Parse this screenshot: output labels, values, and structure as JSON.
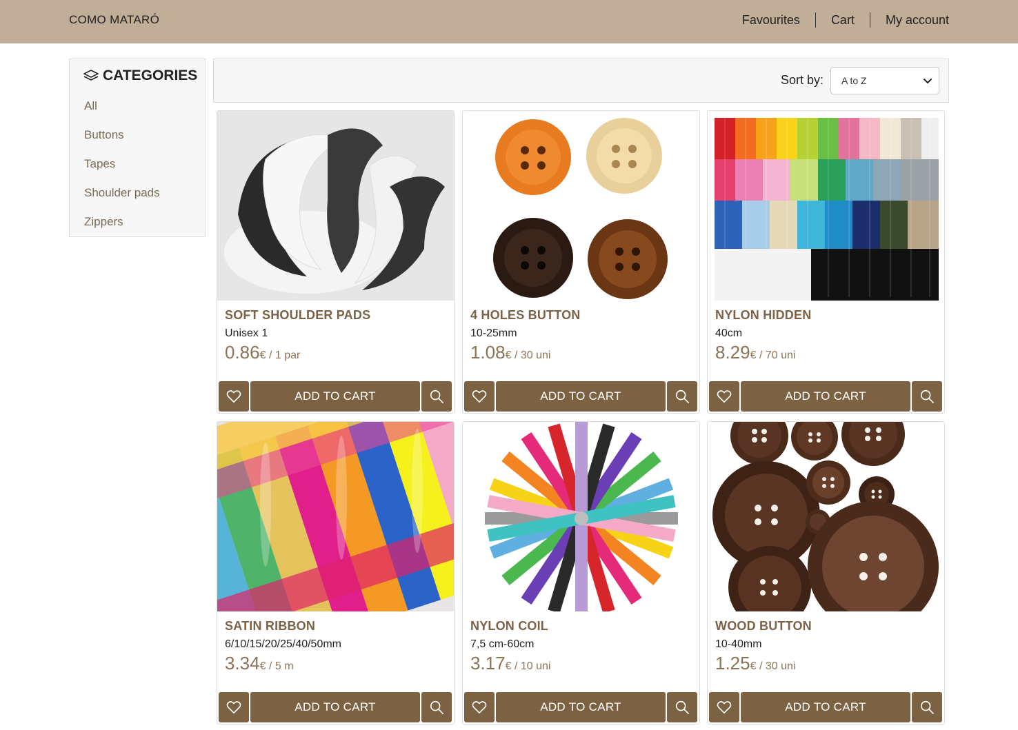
{
  "header": {
    "brand": "COMO MATARÓ",
    "nav": [
      "Favourites",
      "Cart",
      "My account"
    ]
  },
  "sidebar": {
    "title": "CATEGORIES",
    "items": [
      "All",
      "Buttons",
      "Tapes",
      "Shoulder pads",
      "Zippers"
    ]
  },
  "sort": {
    "label": "Sort by:",
    "selected": "A to Z"
  },
  "products": [
    {
      "name": "SOFT SHOULDER PADS",
      "desc": "Unisex 1",
      "price": "0.86",
      "unit": "€ / 1 par",
      "add_label": "ADD TO CART",
      "image": "shoulder-pads"
    },
    {
      "name": "4 HOLES BUTTON",
      "desc": "10-25mm",
      "price": "1.08",
      "unit": "€ / 30 uni",
      "add_label": "ADD TO CART",
      "image": "wood-buttons-four"
    },
    {
      "name": "NYLON HIDDEN",
      "desc": "40cm",
      "price": "8.29",
      "unit": "€ / 70 uni",
      "add_label": "ADD TO CART",
      "image": "zippers-rainbow"
    },
    {
      "name": "SATIN RIBBON",
      "desc": "6/10/15/20/25/40/50mm",
      "price": "3.34",
      "unit": "€ / 5 m",
      "add_label": "ADD TO CART",
      "image": "satin-ribbons"
    },
    {
      "name": "NYLON COIL",
      "desc": "7,5 cm-60cm",
      "price": "3.17",
      "unit": "€ / 10 uni",
      "add_label": "ADD TO CART",
      "image": "zipper-fan"
    },
    {
      "name": "WOOD BUTTON",
      "desc": "10-40mm",
      "price": "1.25",
      "unit": "€ / 30 uni",
      "add_label": "ADD TO CART",
      "image": "wood-buttons-brown"
    }
  ],
  "colors": {
    "header_bg": "#c0ae98",
    "button_bg": "#7c6143",
    "title_text": "#7b6246",
    "price_text": "#8b7356"
  }
}
